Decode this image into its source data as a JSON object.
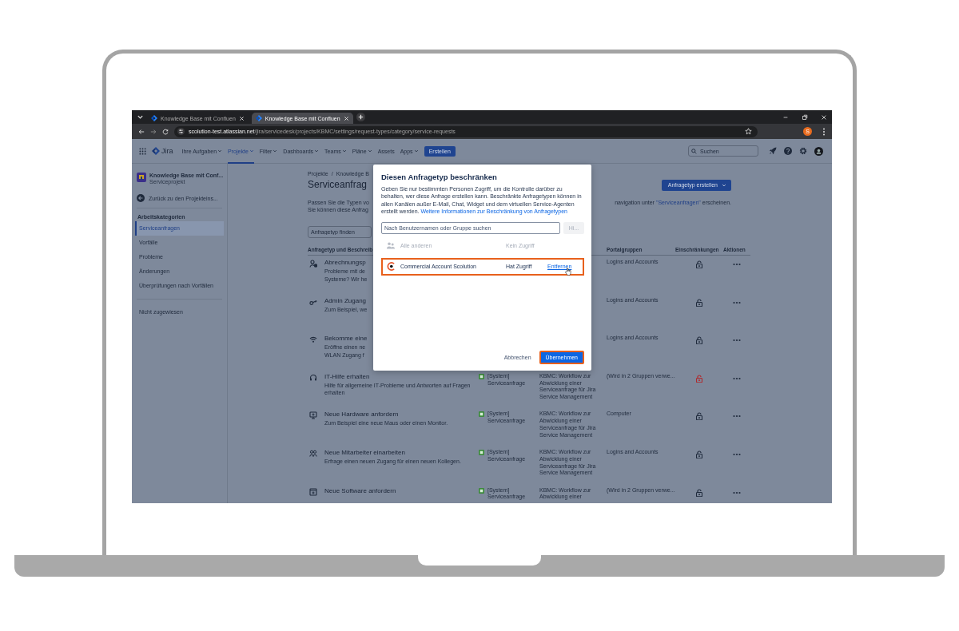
{
  "browser": {
    "tabs": [
      {
        "title": "Knowledge Base mit Confluen",
        "selected": false
      },
      {
        "title": "Knowledge Base mit Confluen",
        "selected": true
      }
    ],
    "url_domain": "scolution-test.atlassian.net",
    "url_path": "/jira/servicedesk/projects/KBMC/settings/request-types/category/service-requests",
    "profile_initial": "S"
  },
  "topnav": {
    "product": "Jira",
    "items": [
      {
        "label": "Ihre Aufgaben",
        "dropdown": true,
        "selected": false
      },
      {
        "label": "Projekte",
        "dropdown": true,
        "selected": true
      },
      {
        "label": "Filter",
        "dropdown": true,
        "selected": false
      },
      {
        "label": "Dashboards",
        "dropdown": true,
        "selected": false
      },
      {
        "label": "Teams",
        "dropdown": true,
        "selected": false
      },
      {
        "label": "Pläne",
        "dropdown": true,
        "selected": false
      },
      {
        "label": "Assets",
        "dropdown": false,
        "selected": false
      },
      {
        "label": "Apps",
        "dropdown": true,
        "selected": false
      }
    ],
    "create_button": "Erstellen",
    "search": {
      "placeholder": "Suchen"
    }
  },
  "sidebar": {
    "project": {
      "name": "Knowledge Base mit Conf...",
      "type": "Serviceprojekt"
    },
    "back_link": "Zurück zu den Projekteins...",
    "section_title": "Arbeitskategorien",
    "items": [
      {
        "label": "Serviceanfragen",
        "selected": true
      },
      {
        "label": "Vorfälle",
        "selected": false
      },
      {
        "label": "Probleme",
        "selected": false
      },
      {
        "label": "Änderungen",
        "selected": false
      },
      {
        "label": "Überprüfungen nach Vorfällen",
        "selected": false
      }
    ],
    "items_2": [
      {
        "label": "Nicht zugewiesen",
        "selected": false
      }
    ]
  },
  "main": {
    "breadcrumb": [
      "Projekte",
      "Knowledge B"
    ],
    "breadcrumb_separator": "/",
    "title": "Serviceanfrag",
    "create_button": "Anfragetyp erstellen",
    "description_left": [
      "Passen Sie die Typen vo",
      "Sie können diese Anfrag"
    ],
    "description_right": {
      "before": "navigation unter ",
      "link": "\"Serviceanfragen\"",
      "after": " erscheinen."
    },
    "search": {
      "placeholder": "Anfragetyp finden"
    }
  },
  "table": {
    "header": {
      "request_type": "Anfragetyp und Beschreib",
      "portal_groups": "Portalgruppen",
      "restrictions": "Einschränkungen",
      "actions": "Aktionen"
    },
    "rows": [
      {
        "kind": "billing",
        "title": "Abrechnungsp",
        "description": [
          "Probleme mit de",
          "Systeme? Wir he"
        ],
        "portal_group": "Logins and Accounts",
        "restricted": false
      },
      {
        "kind": "key",
        "title": "Admin Zugang",
        "description": [
          "Zum Beispiel, we"
        ],
        "portal_group": "Logins and Accounts",
        "restricted": false
      },
      {
        "kind": "wifi",
        "title": "Bekomme eine",
        "description": [
          "Eröffne einen ne",
          "WLAN Zugang f"
        ],
        "portal_group": "Logins and Accounts",
        "restricted": false
      },
      {
        "kind": "headset",
        "title": "IT-Hilfe erhalten",
        "description": [
          "Hilfe für allgemeine IT-Probleme und Antworten auf Fragen erhalten"
        ],
        "issue_type": "[System] Serviceanfrage",
        "workflow": "KBMC: Workflow zur Abwicklung einer Serviceanfrage für Jira Service Management",
        "portal_group": "(Wird in 2 Gruppen verwe...",
        "restricted": true
      },
      {
        "kind": "monitor",
        "title": "Neue Hardware anfordern",
        "description": [
          "Zum Beispiel eine neue Maus oder einen Monitor."
        ],
        "issue_type": "[System] Serviceanfrage",
        "workflow": "KBMC: Workflow zur Abwicklung einer Serviceanfrage für Jira Service Management",
        "portal_group": "Computer",
        "restricted": false
      },
      {
        "kind": "people",
        "title": "Neue Mitarbeiter einarbeiten",
        "description": [
          "Erfrage einen neuen Zugang für einen neuen Kollegen."
        ],
        "issue_type": "[System] Serviceanfrage",
        "workflow": "KBMC: Workflow zur Abwicklung einer Serviceanfrage für Jira Service Management",
        "portal_group": "Logins and Accounts",
        "restricted": false
      },
      {
        "kind": "software",
        "title": "Neue Software anfordern",
        "issue_type": "[System] Serviceanfrage",
        "workflow": "KBMC: Workflow zur Abwicklung einer",
        "portal_group": "(Wird in 2 Gruppen verwe...",
        "restricted": false
      }
    ]
  },
  "dialog": {
    "title": "Diesen Anfragetyp beschränken",
    "text": "Geben Sie nur bestimmten Personen Zugriff, um die Kontrolle darüber zu behalten, wer diese Anfrage erstellen kann. Beschränkte Anfragetypen können in allen Kanälen außer E-Mail, Chat, Widget und dem virtuellen Service-Agenten erstellt werden.",
    "link": "Weitere Informationen zur Beschränkung von Anfragetypen",
    "search": {
      "placeholder": "Nach Benutzernamen oder Gruppe suchen"
    },
    "add_button": {
      "label": "Hi...",
      "disabled": true
    },
    "entries": [
      {
        "kind": "group",
        "name": "Alle anderen",
        "access": "Kein Zugriff",
        "disabled": true,
        "highlighted": false
      },
      {
        "kind": "account",
        "name": "Commercial Account Scolution",
        "access": "Hat Zugriff",
        "action": "Entfernen",
        "disabled": false,
        "highlighted": true
      }
    ],
    "cancel_button": "Abbrechen",
    "apply_button": {
      "label": "Übernehmen",
      "highlighted": true
    }
  }
}
